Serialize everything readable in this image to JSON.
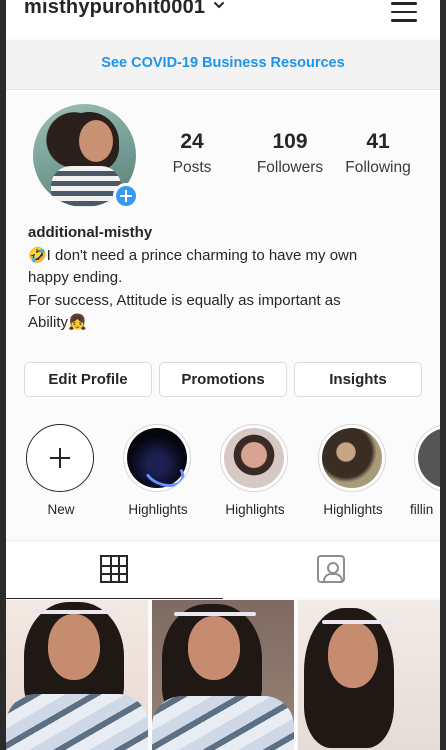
{
  "header": {
    "username": "misthypurohit0001"
  },
  "banner": {
    "covid_link": "See COVID-19 Business Resources"
  },
  "profile": {
    "stats": [
      {
        "value": "24",
        "label": "Posts"
      },
      {
        "value": "109",
        "label": "Followers"
      },
      {
        "value": "41",
        "label": "Following"
      }
    ],
    "display_name": "additional-misthy",
    "bio_line1": "🤣I don't need a prince charming to have my own",
    "bio_line2": "happy ending.",
    "bio_line3": "For success, Attitude is equally as important as",
    "bio_line4": "Ability👧"
  },
  "actions": {
    "edit_profile": "Edit Profile",
    "promotions": "Promotions",
    "insights": "Insights"
  },
  "highlights": [
    {
      "label": "New"
    },
    {
      "label": "Highlights"
    },
    {
      "label": "Highlights"
    },
    {
      "label": "Highlights"
    },
    {
      "label": "fillin"
    }
  ],
  "colors": {
    "accent_blue": "#3897f0",
    "link_blue": "#1f94e8",
    "text": "#262626"
  },
  "icons": {
    "menu": "hamburger-icon",
    "dropdown": "chevron-down-icon",
    "grid_tab": "grid-icon",
    "tagged_tab": "tagged-user-icon",
    "add_story": "plus-icon"
  }
}
